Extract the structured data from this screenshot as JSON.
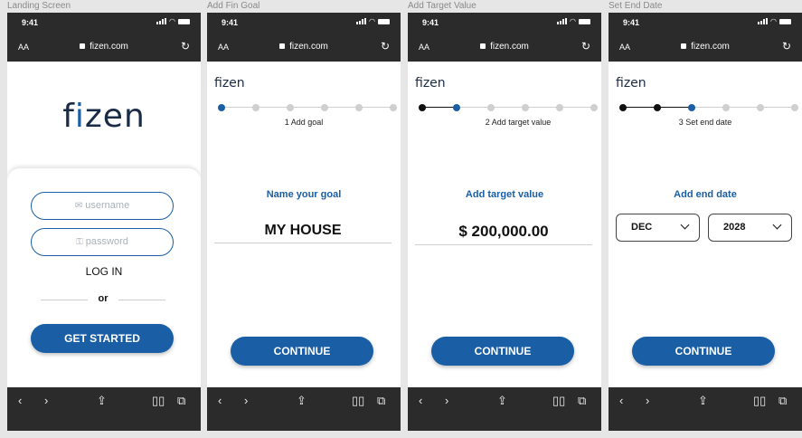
{
  "frames": [
    {
      "title": "Landing Screen"
    },
    {
      "title": "Add Fin Goal"
    },
    {
      "title": "Add Target Value"
    },
    {
      "title": "Set End Date"
    }
  ],
  "browser": {
    "time": "9:41",
    "text_size_label": "AA",
    "url": "fizen.com",
    "reload_icon": "reload-icon",
    "nav_icons": [
      "back-icon",
      "forward-icon",
      "share-icon",
      "bookmarks-icon",
      "tabs-icon"
    ]
  },
  "brand": {
    "logo_text": "fizen",
    "color_primary": "#1a5fa6",
    "color_logo": "#1a2b45"
  },
  "landing": {
    "username_placeholder": "username",
    "password_placeholder": "password",
    "login_label": "LOG IN",
    "or_label": "or",
    "cta_label": "GET STARTED"
  },
  "steps": {
    "total": 6,
    "goal": {
      "current_step": 1,
      "label": "1 Add goal",
      "heading": "Name your goal",
      "value": "MY HOUSE",
      "cta_label": "CONTINUE"
    },
    "target": {
      "current_step": 2,
      "label": "2 Add target value",
      "heading": "Add target value",
      "value": "$ 200,000.00",
      "cta_label": "CONTINUE"
    },
    "end_date": {
      "current_step": 3,
      "label": "3 Set end date",
      "heading": "Add end date",
      "month": "DEC",
      "year": "2028",
      "cta_label": "CONTINUE"
    }
  }
}
